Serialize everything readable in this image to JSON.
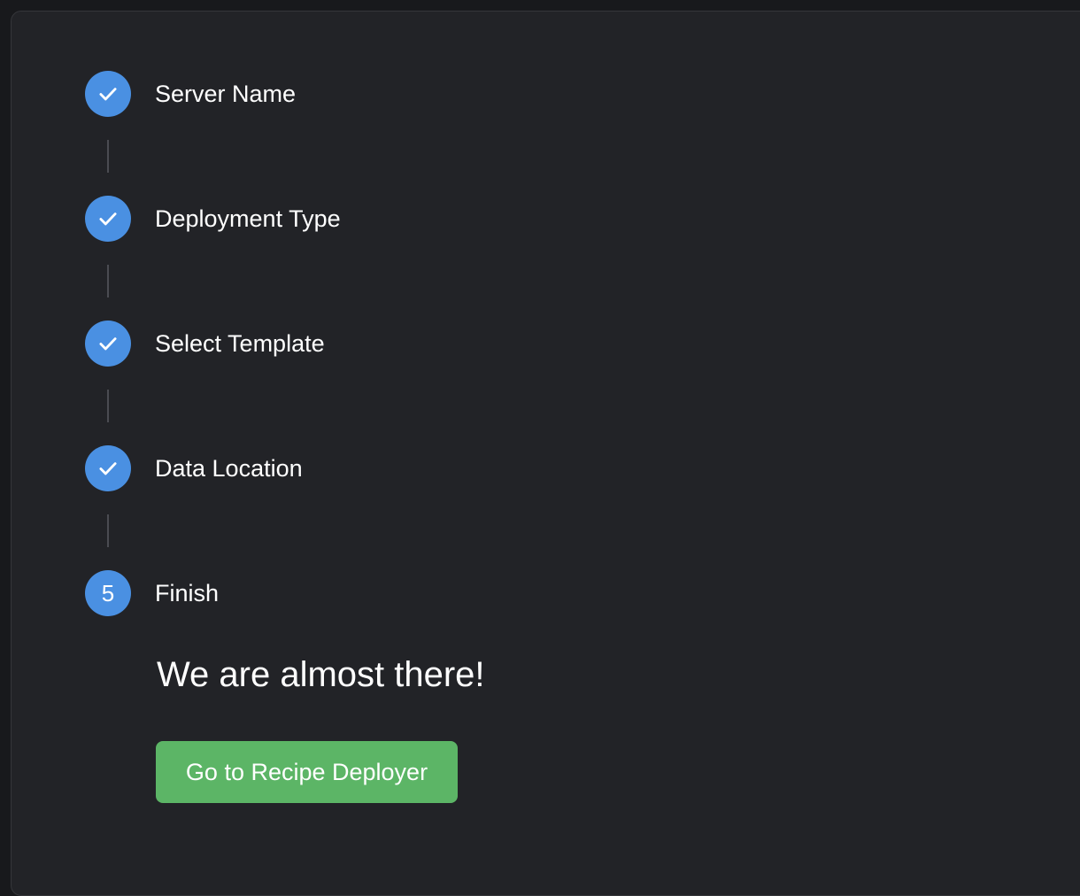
{
  "steps": [
    {
      "label": "Server Name",
      "status": "complete",
      "icon": "check-icon"
    },
    {
      "label": "Deployment Type",
      "status": "complete",
      "icon": "check-icon"
    },
    {
      "label": "Select Template",
      "status": "complete",
      "icon": "check-icon"
    },
    {
      "label": "Data Location",
      "status": "complete",
      "icon": "check-icon"
    },
    {
      "label": "Finish",
      "status": "current",
      "number": "5"
    }
  ],
  "finish": {
    "heading": "We are almost there!",
    "button_label": "Go to Recipe Deployer"
  },
  "colors": {
    "accent": "#4a90e2",
    "success": "#5cb566",
    "panel": "#222327",
    "background": "#18191c",
    "connector": "#4b4c52"
  }
}
